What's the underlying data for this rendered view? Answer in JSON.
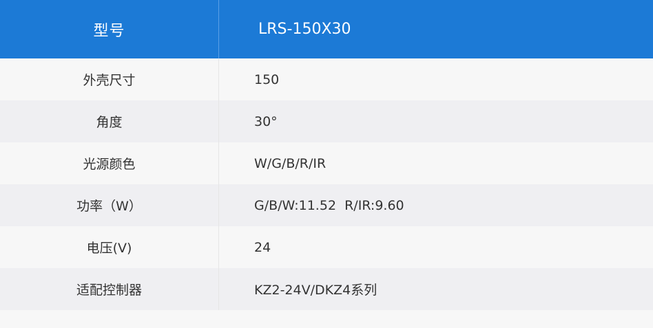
{
  "header": {
    "left": "型号",
    "right": "LRS-150X30"
  },
  "rows": [
    {
      "label": "外壳尺寸",
      "value": "150"
    },
    {
      "label": "角度",
      "value": "30°"
    },
    {
      "label": "光源颜色",
      "value": "W/G/B/R/IR"
    },
    {
      "label": "功率（W）",
      "value": "G/B/W:11.52  R/IR:9.60"
    },
    {
      "label": "电压(V)",
      "value": "24"
    },
    {
      "label": "适配控制器",
      "value": "KZ2-24V/DKZ4系列"
    }
  ],
  "colors": {
    "header_bg": "#1c7ad6",
    "row_odd": "#f7f7f7",
    "row_even": "#efeff2",
    "text": "#333333"
  }
}
